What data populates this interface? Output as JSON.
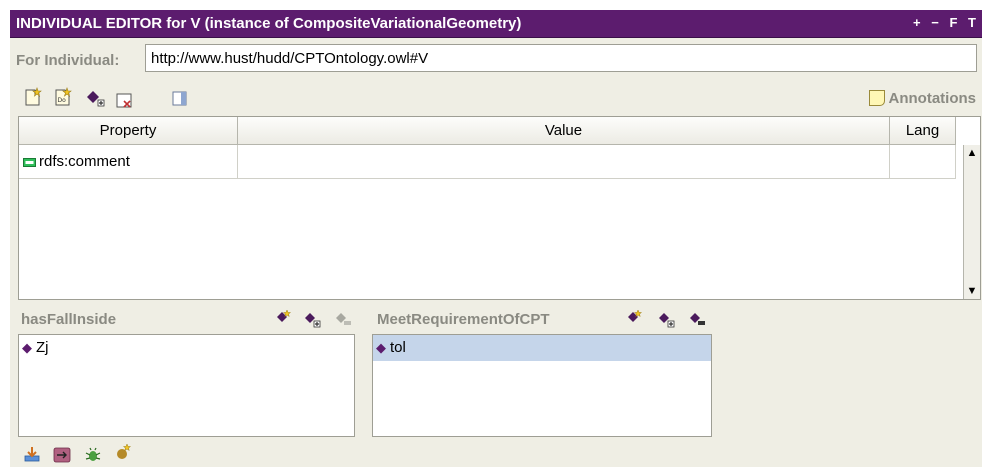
{
  "title": "INDIVIDUAL EDITOR for V   (instance of CompositeVariationalGeometry)",
  "title_controls": [
    "+",
    "−",
    "F",
    "T"
  ],
  "for_individual": {
    "label": "For Individual:",
    "value": "http://www.hust/hudd/CPTOntology.owl#V"
  },
  "toolbar_icons": [
    "create-property-value-icon",
    "create-property-value-template-icon",
    "add-property-icon",
    "delete-row-icon",
    "view-icon"
  ],
  "annotations_label": "Annotations",
  "table": {
    "columns": [
      "Property",
      "Value",
      "Lang"
    ],
    "rows": [
      {
        "property": "rdfs:comment",
        "value": "",
        "lang": ""
      }
    ]
  },
  "has_fall_inside": {
    "label": "hasFallInside",
    "items": [
      "Zj"
    ]
  },
  "meet_requirement": {
    "label": "MeetRequirementOfCPT",
    "items": [
      "tol"
    ]
  },
  "bottom_icons": [
    "download-icon",
    "arrow-right-icon",
    "bug-icon",
    "add-instance-icon"
  ],
  "colors": {
    "titlebar": "#5c1c6e",
    "panel": "#efeee4",
    "selection": "#c5d5ea"
  }
}
